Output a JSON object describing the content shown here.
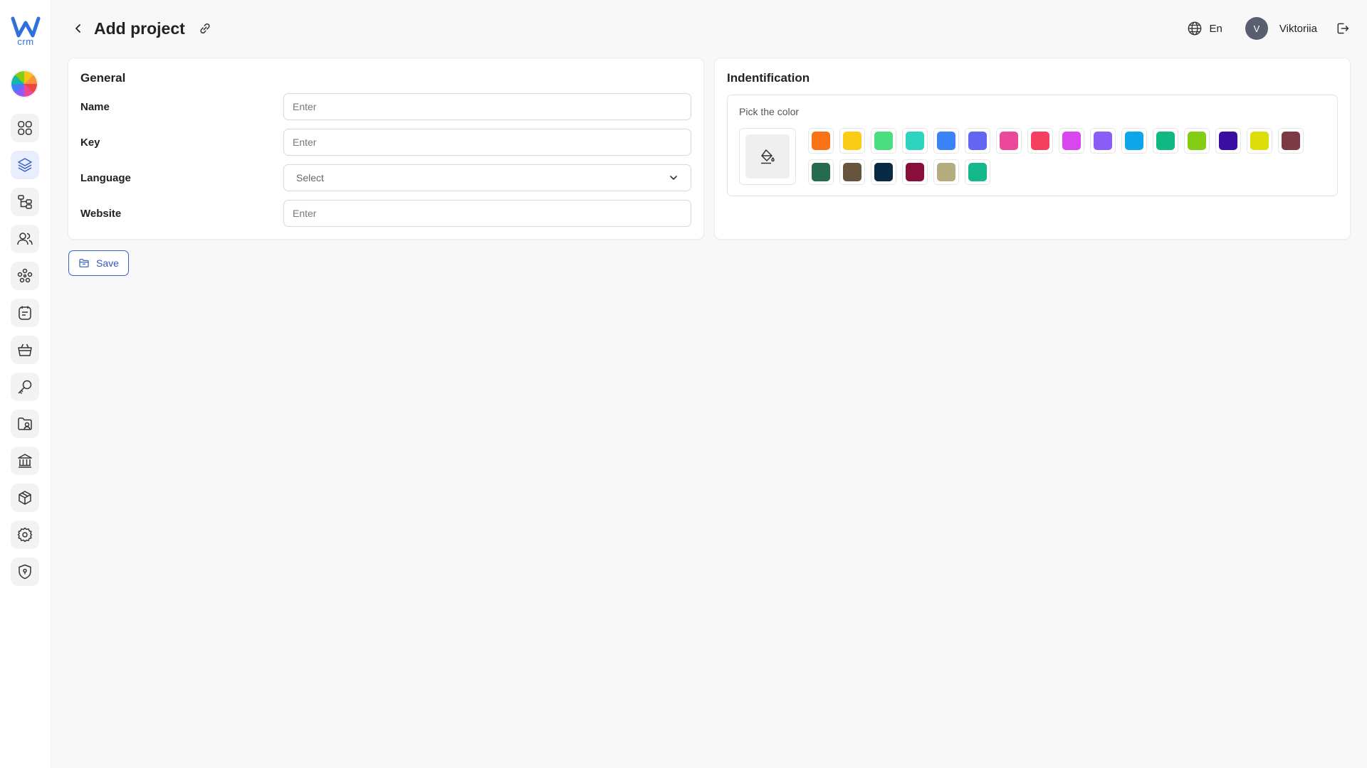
{
  "app": {
    "logo_text": "crm"
  },
  "header": {
    "title": "Add project",
    "language": "En",
    "user": {
      "initial": "V",
      "name": "Viktoriia"
    }
  },
  "sidebar": {
    "items": [
      {
        "icon": "dashboard-grid-icon",
        "active": false
      },
      {
        "icon": "layers-icon",
        "active": true
      },
      {
        "icon": "hierarchy-icon",
        "active": false
      },
      {
        "icon": "users-icon",
        "active": false
      },
      {
        "icon": "team-network-icon",
        "active": false
      },
      {
        "icon": "notes-icon",
        "active": false
      },
      {
        "icon": "basket-icon",
        "active": false
      },
      {
        "icon": "key-icon",
        "active": false
      },
      {
        "icon": "folder-image-icon",
        "active": false
      },
      {
        "icon": "bank-icon",
        "active": false
      },
      {
        "icon": "box-icon",
        "active": false
      },
      {
        "icon": "settings-gear-icon",
        "active": false
      },
      {
        "icon": "shield-icon",
        "active": false
      }
    ]
  },
  "general": {
    "title": "General",
    "fields": {
      "name": {
        "label": "Name",
        "placeholder": "Enter",
        "value": ""
      },
      "key": {
        "label": "Key",
        "placeholder": "Enter",
        "value": ""
      },
      "language": {
        "label": "Language",
        "selected": "Select"
      },
      "website": {
        "label": "Website",
        "placeholder": "Enter",
        "value": ""
      }
    }
  },
  "identification": {
    "title": "Indentification",
    "pick_label": "Pick the color",
    "colors": [
      "#f97316",
      "#facc15",
      "#4ade80",
      "#2dd4bf",
      "#3b82f6",
      "#6366f1",
      "#ec4899",
      "#f43f5e",
      "#d946ef",
      "#8b5cf6",
      "#0ea5e9",
      "#10b981",
      "#84cc16",
      "#3b0ea3",
      "#dddd0c",
      "#7c3a44",
      "#276b4e",
      "#67543f",
      "#082a45",
      "#8a0e3c",
      "#b5ad7f",
      "#14b88a"
    ]
  },
  "actions": {
    "save_label": "Save"
  }
}
